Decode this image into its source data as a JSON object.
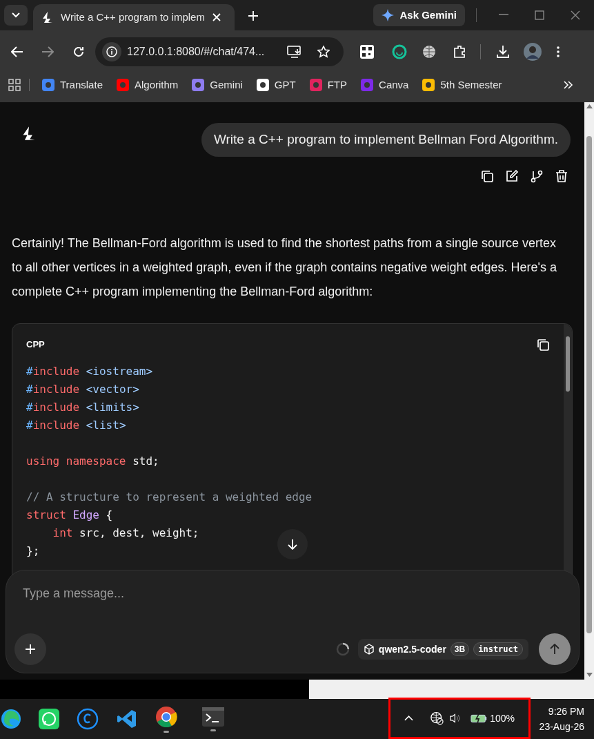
{
  "browser": {
    "tab_title": "Write a C++ program to implem",
    "ask_button": "Ask Gemini",
    "address": "127.0.0.1:8080/#/chat/474...",
    "bookmarks": [
      {
        "label": "Translate",
        "color": "#4285f4"
      },
      {
        "label": "Algorithm",
        "color": "#ff0000"
      },
      {
        "label": "Gemini",
        "color": "#8e7cf0"
      },
      {
        "label": "GPT",
        "color": "#ffffff"
      },
      {
        "label": "FTP",
        "color": "#e0245e"
      },
      {
        "label": "Canva",
        "color": "#7d2ae8"
      },
      {
        "label": "5th Semester",
        "color": "#fbbc04"
      }
    ]
  },
  "chat": {
    "user_message": "Write a C++ program to implement Bellman Ford Algorithm.",
    "assistant_intro": "Certainly! The Bellman-Ford algorithm is used to find the shortest paths from a single source vertex to all other vertices in a weighted graph, even if the graph contains negative weight edges. Here's a complete C++ program implementing the Bellman-Ford algorithm:",
    "code_block": {
      "language": "CPP",
      "lines": [
        {
          "kind": "code",
          "tokens": [
            {
              "text": "#",
              "kind": "hash"
            },
            {
              "text": "include",
              "kind": "keyword"
            },
            {
              "text": " <iostream>",
              "kind": "header"
            }
          ]
        },
        {
          "kind": "code",
          "tokens": [
            {
              "text": "#",
              "kind": "hash"
            },
            {
              "text": "include",
              "kind": "keyword"
            },
            {
              "text": " <vector>",
              "kind": "header"
            }
          ]
        },
        {
          "kind": "code",
          "tokens": [
            {
              "text": "#",
              "kind": "hash"
            },
            {
              "text": "include",
              "kind": "keyword"
            },
            {
              "text": " <limits>",
              "kind": "header"
            }
          ]
        },
        {
          "kind": "code",
          "tokens": [
            {
              "text": "#",
              "kind": "hash"
            },
            {
              "text": "include",
              "kind": "keyword"
            },
            {
              "text": " <list>",
              "kind": "header"
            }
          ]
        },
        {
          "kind": "blank"
        },
        {
          "kind": "code",
          "tokens": [
            {
              "text": "using",
              "kind": "keyword"
            },
            {
              "text": " namespace",
              "kind": "keyword"
            },
            {
              "text": " std;",
              "kind": "plain"
            }
          ]
        },
        {
          "kind": "blank"
        },
        {
          "kind": "code",
          "tokens": [
            {
              "text": "// A structure to represent a weighted edge",
              "kind": "comment"
            }
          ]
        },
        {
          "kind": "code",
          "tokens": [
            {
              "text": "struct",
              "kind": "keyword"
            },
            {
              "text": " Edge",
              "kind": "type"
            },
            {
              "text": " {",
              "kind": "plain"
            }
          ]
        },
        {
          "kind": "code",
          "tokens": [
            {
              "text": "    int",
              "kind": "keyword"
            },
            {
              "text": " src, dest, weight;",
              "kind": "plain"
            }
          ]
        },
        {
          "kind": "code",
          "tokens": [
            {
              "text": "};",
              "kind": "plain"
            }
          ]
        }
      ]
    }
  },
  "composer": {
    "placeholder": "Type a message...",
    "model": "qwen2.5-coder",
    "model_size": "3B",
    "model_variant": "instruct"
  },
  "taskbar": {
    "battery": "100%",
    "time": "9:26 PM",
    "date": "23-Aug-26"
  }
}
